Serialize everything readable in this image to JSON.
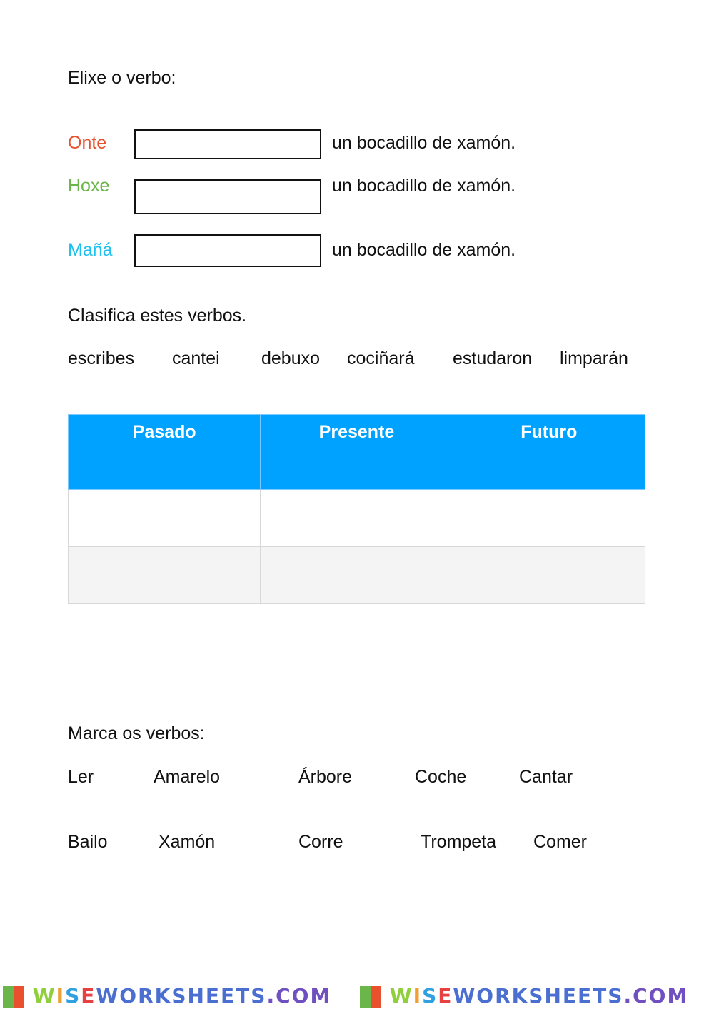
{
  "section1": {
    "title": "Elixe o verbo:",
    "rows": [
      {
        "label": "Onte",
        "color": "#e8502e",
        "value": "",
        "suffix": "un bocadillo de xamón."
      },
      {
        "label": "Hoxe",
        "color": "#6ab64a",
        "value": "",
        "suffix": "un bocadillo de xamón."
      },
      {
        "label": "Mañá",
        "color": "#1ec0ef",
        "value": "",
        "suffix": "un bocadillo de xamón."
      }
    ]
  },
  "section2": {
    "title": "Clasifica estes verbos.",
    "words": [
      "escribes",
      "cantei",
      "debuxo",
      "cociñará",
      "estudaron",
      "limparán"
    ],
    "table": {
      "headers": [
        "Pasado",
        "Presente",
        "Futuro"
      ],
      "header_color": "#00a2ff"
    }
  },
  "section3": {
    "title": "Marca os verbos:",
    "row1": [
      "Ler",
      "Amarelo",
      "Árbore",
      "Coche",
      "Cantar"
    ],
    "row2": [
      "Bailo",
      "Xamón",
      "Corre",
      "Trompeta",
      "Comer"
    ]
  },
  "footer": {
    "logo_text": "WISEWORKSHEETS.COM"
  }
}
